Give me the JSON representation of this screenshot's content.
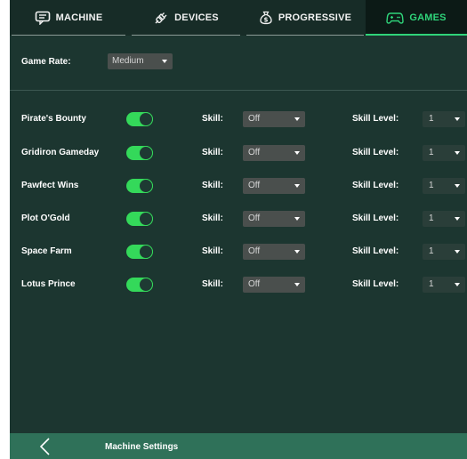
{
  "tabs": [
    {
      "label": "MACHINE",
      "icon": "monitor-chat-icon",
      "active": false
    },
    {
      "label": "DEVICES",
      "icon": "plug-icon",
      "active": false
    },
    {
      "label": "PROGRESSIVE",
      "icon": "money-bag-icon",
      "active": false
    },
    {
      "label": "GAMES",
      "icon": "gamepad-icon",
      "active": true
    }
  ],
  "game_rate": {
    "label": "Game Rate:",
    "value": "Medium"
  },
  "games": [
    {
      "name": "Pirate's Bounty",
      "enabled": true,
      "skill_label": "Skill:",
      "skill": "Off",
      "level_label": "Skill Level:",
      "level": "1"
    },
    {
      "name": "Gridiron Gameday",
      "enabled": true,
      "skill_label": "Skill:",
      "skill": "Off",
      "level_label": "Skill Level:",
      "level": "1"
    },
    {
      "name": "Pawfect Wins",
      "enabled": true,
      "skill_label": "Skill:",
      "skill": "Off",
      "level_label": "Skill Level:",
      "level": "1"
    },
    {
      "name": "Plot O'Gold",
      "enabled": true,
      "skill_label": "Skill:",
      "skill": "Off",
      "level_label": "Skill Level:",
      "level": "1"
    },
    {
      "name": "Space Farm",
      "enabled": true,
      "skill_label": "Skill:",
      "skill": "Off",
      "level_label": "Skill Level:",
      "level": "1"
    },
    {
      "name": "Lotus Prince",
      "enabled": true,
      "skill_label": "Skill:",
      "skill": "Off",
      "level_label": "Skill Level:",
      "level": "1"
    }
  ],
  "footer": {
    "title": "Machine Settings",
    "back_icon": "chevron-left-icon"
  },
  "colors": {
    "accent": "#2fd47a",
    "toggle_on": "#34d95a",
    "background": "#1c3630",
    "footer": "#2f7159"
  }
}
